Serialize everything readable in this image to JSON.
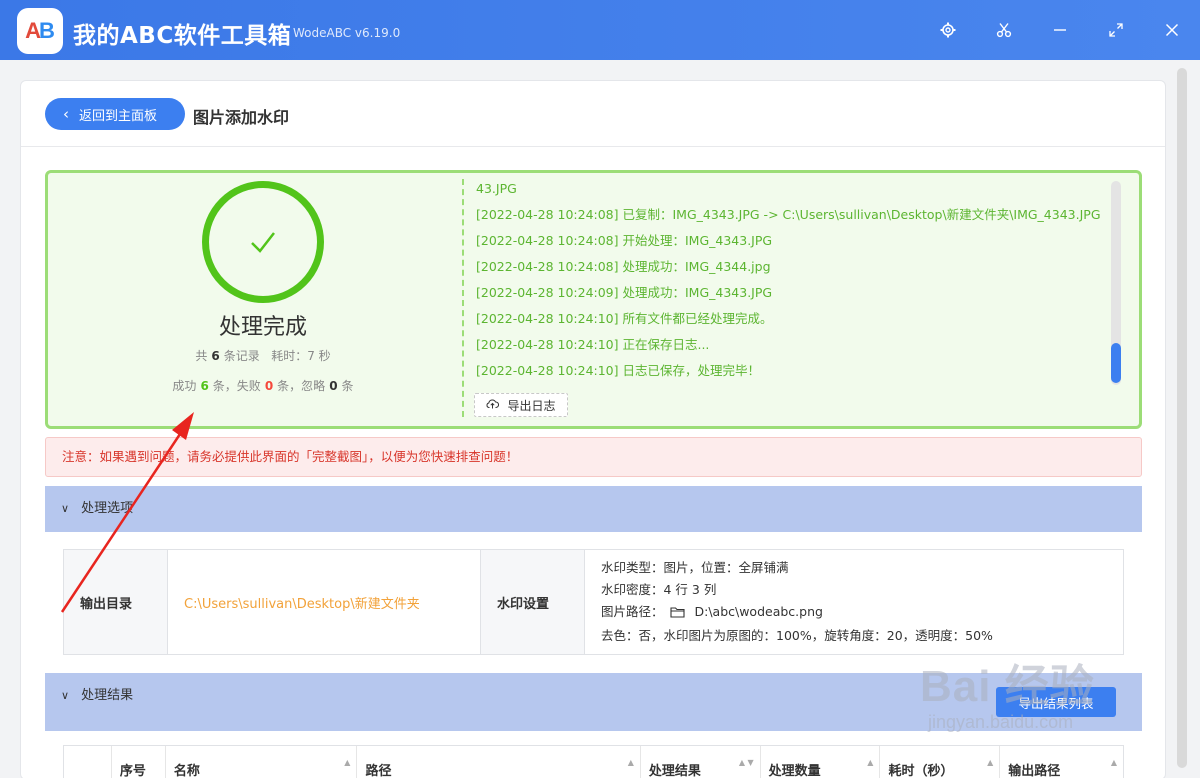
{
  "app": {
    "title": "我的ABC软件工具箱",
    "version": "WodeABC v6.19.0",
    "logo_a": "A",
    "logo_b": "B"
  },
  "titlebar_icons": [
    "gear-icon",
    "scissors-icon",
    "minimize-icon",
    "maximize-icon",
    "close-icon"
  ],
  "header": {
    "back_label": "返回到主面板",
    "page_title": "图片添加水印"
  },
  "result": {
    "status": "处理完成",
    "total_prefix": "共",
    "total_count": "6",
    "total_suffix": "条记录",
    "elapsed": "耗时：7 秒",
    "success_prefix": "成功",
    "success_count": "6",
    "success_suffix": "条，失败",
    "fail_count": "0",
    "fail_suffix": "条，忽略",
    "ignore_count": "0",
    "ignore_suffix": "条"
  },
  "log": {
    "lines": [
      "43.JPG",
      "[2022-04-28 10:24:08] 已复制：IMG_4343.JPG -> C:\\Users\\sullivan\\Desktop\\新建文件夹\\IMG_4343.JPG",
      "[2022-04-28 10:24:08] 开始处理：IMG_4343.JPG",
      "[2022-04-28 10:24:08] 处理成功：IMG_4344.jpg",
      "[2022-04-28 10:24:09] 处理成功：IMG_4343.JPG",
      "[2022-04-28 10:24:10] 所有文件都已经处理完成。",
      "[2022-04-28 10:24:10] 正在保存日志...",
      "[2022-04-28 10:24:10] 日志已保存，处理完毕！"
    ],
    "export_label": "导出日志"
  },
  "notice": "注意：如果遇到问题，请务必提供此界面的「完整截图」，以便为您快速排查问题！",
  "options_section": {
    "title": "处理选项",
    "output_dir_label": "输出目录",
    "output_dir_value": "C:\\Users\\sullivan\\Desktop\\新建文件夹",
    "watermark_label": "水印设置",
    "watermark_lines": [
      "水印类型：图片，位置：全屏铺满",
      "水印密度：4 行 3 列",
      "图片路径：",
      "去色：否，水印图片为原图的：100%，旋转角度：20，透明度：50%"
    ],
    "image_path": "D:\\abc\\wodeabc.png"
  },
  "results_section": {
    "title": "处理结果",
    "export_list_label": "导出结果列表",
    "columns": [
      "",
      "序号",
      "名称",
      "路径",
      "处理结果",
      "处理数量",
      "耗时（秒）",
      "输出路径"
    ]
  },
  "watermark_overlay": {
    "big": "Bai 经验",
    "small": "jingyan.baidu.com"
  },
  "colors": {
    "titlebar": "#3b78e7",
    "accent": "#3c7ff0",
    "success": "#52c41a",
    "error": "#f5483b",
    "path": "#f2a23a",
    "annotation_arrow": "#e8251f"
  }
}
